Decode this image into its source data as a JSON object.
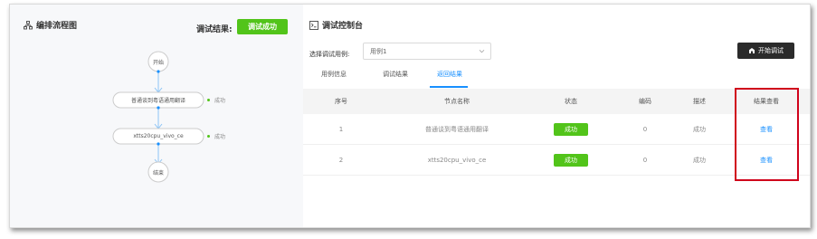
{
  "flow_panel": {
    "title": "编排流程图",
    "title_icon": "flowchart-icon",
    "result_label": "调试结果:",
    "result_badge": "调试成功",
    "nodes": {
      "start": "开始",
      "step1": "普通谈到粤语通用翻译",
      "step2": "xtts20cpu_vivo_ce",
      "end": "结束"
    },
    "node_status": [
      "成功",
      "成功"
    ]
  },
  "console": {
    "title": "调试控制台",
    "title_icon": "console-icon",
    "select_label": "选择调试用例:",
    "select_value": "用例1",
    "start_button": "开始调试",
    "tabs": [
      "用例信息",
      "调试结果",
      "返回结果"
    ],
    "active_tab_index": 2
  },
  "table": {
    "headers": [
      "序号",
      "节点名称",
      "状态",
      "编码",
      "描述",
      "结果查看"
    ],
    "rows": [
      {
        "index": "1",
        "name": "普通谈到粤语通用翻译",
        "status": "成功",
        "code": "0",
        "desc": "成功",
        "view": "查看"
      },
      {
        "index": "2",
        "name": "xtts20cpu_vivo_ce",
        "status": "成功",
        "code": "0",
        "desc": "成功",
        "view": "查看"
      }
    ]
  },
  "colors": {
    "success": "#52c41a",
    "link": "#1890ff",
    "highlight": "#d0021b",
    "button_dark": "#2b2b2b"
  }
}
